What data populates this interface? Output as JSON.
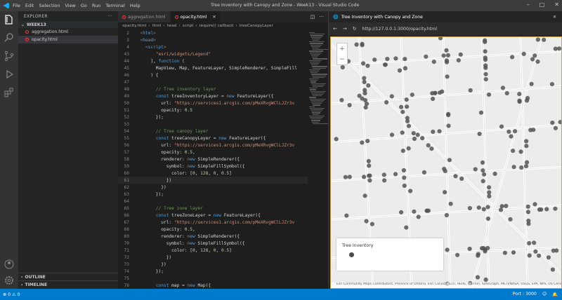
{
  "titlebar": {
    "menu": [
      "File",
      "Edit",
      "Selection",
      "View",
      "Go",
      "Run",
      "Terminal",
      "Help"
    ],
    "title": "Tree Inventory with Canopy and Zone - Week13 - Visual Studio Code"
  },
  "sidebar": {
    "header": "EXPLORER",
    "folder": "WEEK13",
    "files": [
      "aggregation.html",
      "opacity.html"
    ],
    "active_file_index": 1,
    "outline": "OUTLINE",
    "timeline": "TIMELINE"
  },
  "editor": {
    "tabs": [
      {
        "label": "aggregation.html",
        "active": false
      },
      {
        "label": "opacity.html",
        "active": true
      }
    ],
    "breadcrumb": [
      "opacity.html",
      "html",
      "head",
      "script",
      "require() callback",
      "treeCanopyLayer"
    ],
    "lines": [
      {
        "n": "2",
        "t": "  <html>"
      },
      {
        "n": "3",
        "t": "  <head>"
      },
      {
        "n": "4",
        "t": "    <script>"
      },
      {
        "n": "43",
        "t": "        \"esri/widgets/Legend\""
      },
      {
        "n": "44",
        "t": "      ], function ("
      },
      {
        "n": "45",
        "t": "        MapView, Map, FeatureLayer, SimpleRenderer, SimpleFill"
      },
      {
        "n": "46",
        "t": "      ) {"
      },
      {
        "n": "47",
        "t": ""
      },
      {
        "n": "48",
        "t": "        // Tree inventory layer"
      },
      {
        "n": "49",
        "t": "        const treeInventoryLayer = new FeatureLayer({"
      },
      {
        "n": "50",
        "t": "          url: \"https://services1.arcgis.com/pMeXRvgWClLJZr3v"
      },
      {
        "n": "51",
        "t": "          opacity: 0.5"
      },
      {
        "n": "52",
        "t": "        });"
      },
      {
        "n": "53",
        "t": ""
      },
      {
        "n": "54",
        "t": "        // Tree canopy layer"
      },
      {
        "n": "55",
        "t": "        const treeCanopyLayer = new FeatureLayer({"
      },
      {
        "n": "56",
        "t": "          url: \"https://services1.arcgis.com/pMeXRvgWClLJZr3v"
      },
      {
        "n": "57",
        "t": "          opacity: 0.5,"
      },
      {
        "n": "58",
        "t": "          renderer: new SimpleRenderer({"
      },
      {
        "n": "59",
        "t": "            symbol: new SimpleFillSymbol({"
      },
      {
        "n": "60",
        "t": "              color: [0, 128, 0, 0.5]"
      },
      {
        "n": "61",
        "t": "            })"
      },
      {
        "n": "62",
        "t": "          })"
      },
      {
        "n": "63",
        "t": "        });"
      },
      {
        "n": "64",
        "t": ""
      },
      {
        "n": "65",
        "t": "        // Tree zone layer"
      },
      {
        "n": "66",
        "t": "        const treeZoneLayer = new FeatureLayer({"
      },
      {
        "n": "67",
        "t": "          url: \"https://services1.arcgis.com/pMeXRvgWClLJZr3v"
      },
      {
        "n": "68",
        "t": "          opacity: 0.5,"
      },
      {
        "n": "69",
        "t": "          renderer: new SimpleRenderer({"
      },
      {
        "n": "70",
        "t": "            symbol: new SimpleFillSymbol({"
      },
      {
        "n": "71",
        "t": "              color: [0, 128, 0, 0.5]"
      },
      {
        "n": "72",
        "t": "            })"
      },
      {
        "n": "73",
        "t": "          })"
      },
      {
        "n": "74",
        "t": "        });"
      },
      {
        "n": "75",
        "t": ""
      },
      {
        "n": "76",
        "t": "        const map = new Map({"
      }
    ]
  },
  "browser": {
    "tab_title": "Tree Inventory with Canopy and Zone",
    "url": "http://127.0.0.1:3000/opacity.html",
    "legend_title": "Tree Inventory",
    "attribution": "Esri Community Maps Contributors, Province of Ontario, Esri Canada, Esri, HERE, Garmin, SafeGraph, METI/NASA, USGS, EPA, NPS, US Census Bureau"
  },
  "statusbar": {
    "left": "⊗ 0  ⚠ 0",
    "right": [
      "Port : 3000"
    ]
  },
  "colors": {
    "accent": "#007acc",
    "keyword": "#569cd6",
    "string": "#ce9178",
    "comment": "#6a9955",
    "number": "#b5cea8",
    "tree_point": "#555555"
  }
}
